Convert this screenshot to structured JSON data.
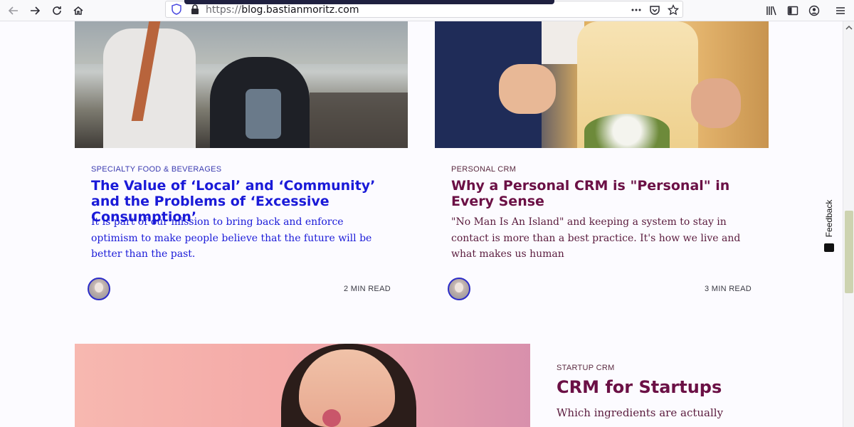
{
  "browser": {
    "url_scheme": "https://",
    "url_host": "blog.bastianmoritz.com"
  },
  "feedback": {
    "label": "Feedback"
  },
  "posts": [
    {
      "category": "SPECIALTY FOOD & BEVERAGES",
      "title": "The Value of ‘Local’ and ‘Community’ and the Problems of ‘Excessive Consumption’",
      "excerpt": "It is part of our mission to bring back and enforce optimism to make people believe that the future will be better than the past.",
      "read_time": "2 MIN READ"
    },
    {
      "category": "PERSONAL CRM",
      "title": "Why a Personal CRM is \"Personal\" in Every Sense",
      "excerpt": "\"No Man Is An Island\" and keeping a system to stay in contact is more than a best practice. It's how we live and what makes us human",
      "read_time": "3 MIN READ"
    },
    {
      "category": "STARTUP CRM",
      "title": "CRM for Startups",
      "excerpt": "Which ingredients are actually"
    }
  ],
  "colors": {
    "post1_accent": "#1a1ad8",
    "post2_accent": "#6b1045",
    "background": "#fcfbff"
  }
}
